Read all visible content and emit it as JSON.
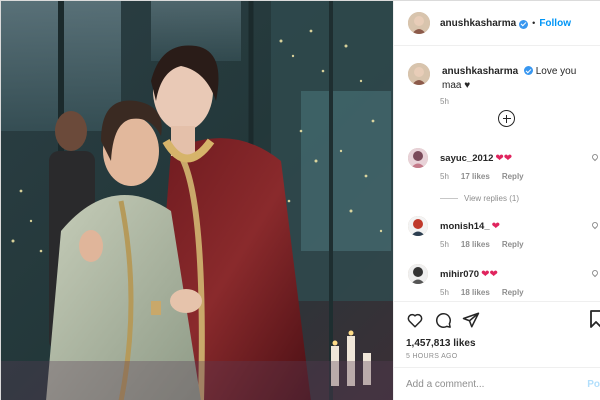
{
  "header": {
    "username": "anushkasharma",
    "separator": "•",
    "follow_label": "Follow"
  },
  "caption": {
    "username": "anushkasharma",
    "text": "Love you maa",
    "emoji": "♥",
    "time": "5h"
  },
  "comments": [
    {
      "username": "sayuc_2012",
      "hearts": "❤❤",
      "time": "5h",
      "likes": "17 likes",
      "reply": "Reply"
    },
    {
      "username": "monish14_",
      "hearts": "❤",
      "time": "5h",
      "likes": "18 likes",
      "reply": "Reply"
    },
    {
      "username": "mihir070",
      "hearts": "❤❤",
      "time": "5h",
      "likes": "18 likes",
      "reply": "Reply"
    }
  ],
  "view_replies": "View replies (1)",
  "post_meta": {
    "likes": "1,457,813 likes",
    "time_ago": "5 HOURS AGO"
  },
  "add_comment": {
    "placeholder": "Add a comment...",
    "post_label": "Po"
  },
  "colors": {
    "link_blue": "#0095f6",
    "heart_red": "#e0245e",
    "muted": "#8e8e8e"
  }
}
